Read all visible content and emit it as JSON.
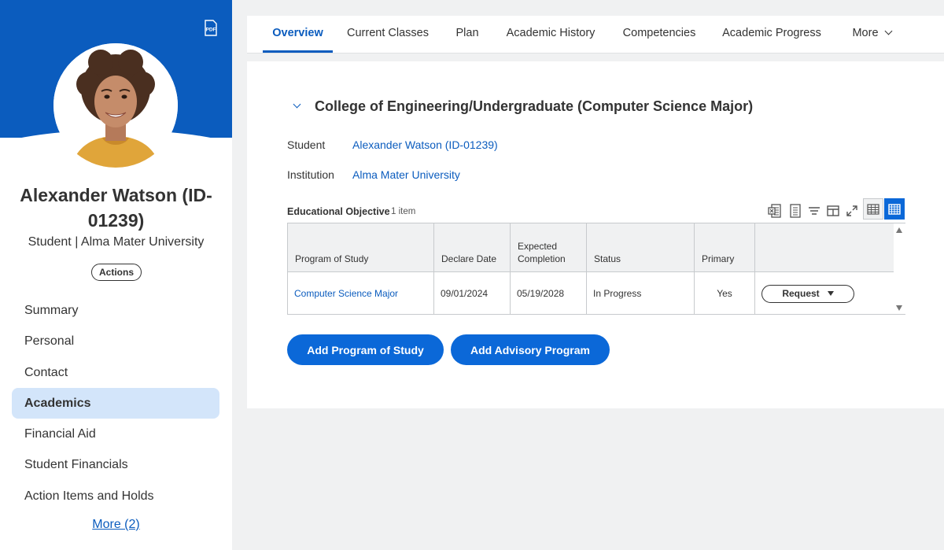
{
  "sidebar": {
    "profile_name": "Alexander Watson (ID-01239)",
    "profile_subtitle": "Student | Alma Mater University",
    "actions_label": "Actions",
    "pdf_label": "PDF",
    "items": [
      {
        "label": "Summary"
      },
      {
        "label": "Personal"
      },
      {
        "label": "Contact"
      },
      {
        "label": "Academics",
        "active": true
      },
      {
        "label": "Financial Aid"
      },
      {
        "label": "Student Financials"
      },
      {
        "label": "Action Items and Holds"
      }
    ],
    "more_label": "More (2)"
  },
  "tabs": [
    {
      "label": "Overview",
      "active": true
    },
    {
      "label": "Current Classes"
    },
    {
      "label": "Plan"
    },
    {
      "label": "Academic History"
    },
    {
      "label": "Competencies"
    },
    {
      "label": "Academic Progress"
    },
    {
      "label": "More"
    }
  ],
  "section": {
    "title": "College of Engineering/Undergraduate (Computer Science Major)",
    "student_label": "Student",
    "student_value": "Alexander Watson (ID-01239)",
    "institution_label": "Institution",
    "institution_value": "Alma Mater University"
  },
  "grid": {
    "title": "Educational Objective",
    "count": "1 item",
    "headers": {
      "program": "Program of Study",
      "declare": "Declare Date",
      "expected": "Expected Completion",
      "status": "Status",
      "primary": "Primary"
    },
    "row": {
      "program": "Computer Science Major",
      "declare": "09/01/2024",
      "expected": "05/19/2028",
      "status": "In Progress",
      "primary": "Yes",
      "action_label": "Request"
    }
  },
  "buttons": {
    "add_program": "Add Program of Study",
    "add_advisory": "Add Advisory Program"
  },
  "colors": {
    "brand_blue": "#0b5cbe",
    "button_blue": "#0b68d8",
    "active_nav": "#d3e5fa",
    "page_bg": "#f0f1f2"
  }
}
